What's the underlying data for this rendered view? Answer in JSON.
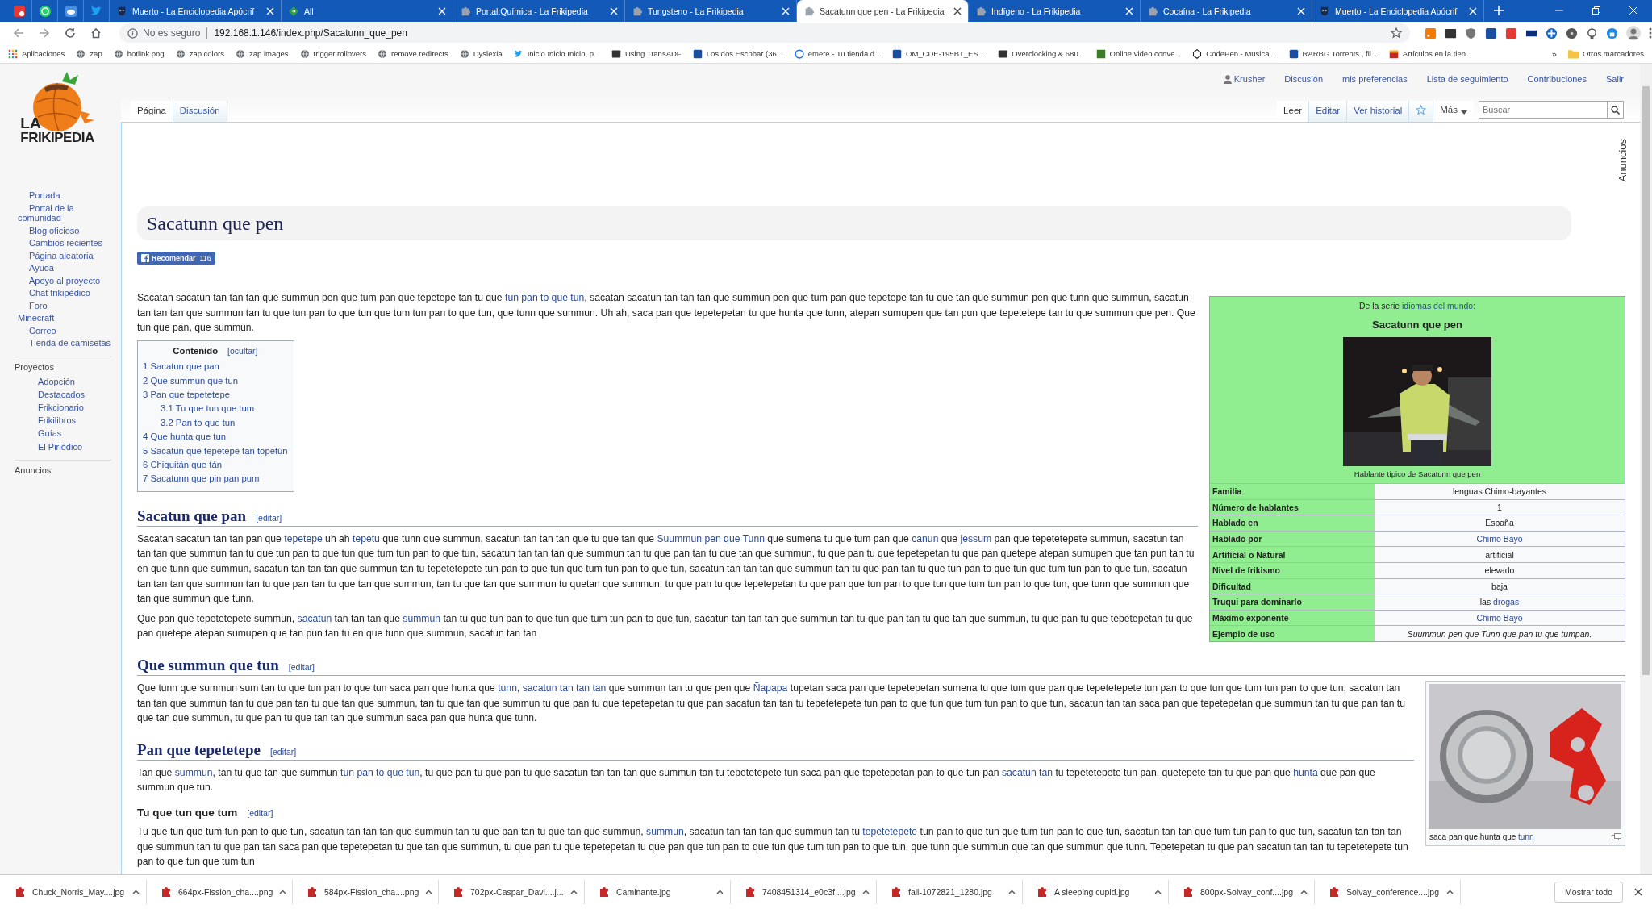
{
  "browser": {
    "pinned_tabs": [
      {
        "kind": "square"
      },
      {
        "kind": "chat"
      },
      {
        "kind": "cloud"
      },
      {
        "kind": "bird"
      }
    ],
    "tabs": [
      {
        "title": "Muerto - La Enciclopedia Apócrif",
        "kind": "mask",
        "selected": false
      },
      {
        "title": "All",
        "kind": "diamond",
        "selected": false
      },
      {
        "title": "Portal:Química - La Frikipedia",
        "kind": "puzzle",
        "selected": false
      },
      {
        "title": "Tungsteno - La Frikipedia",
        "kind": "puzzle",
        "selected": false
      },
      {
        "title": "Sacatunn que pen - La Frikipedia",
        "kind": "puzzle",
        "selected": true
      },
      {
        "title": "Indígeno - La Frikipedia",
        "kind": "puzzle",
        "selected": false
      },
      {
        "title": "Cocaína - La Frikipedia",
        "kind": "puzzle",
        "selected": false
      },
      {
        "title": "Muerto - La Enciclopedia Apócrif",
        "kind": "mask",
        "selected": false
      }
    ],
    "address": {
      "security": "No es seguro",
      "url": "192.168.1.146/index.php/Sacatunn_que_pen"
    },
    "extensions": [
      {
        "kind": "rss"
      },
      {
        "kind": "tile"
      },
      {
        "kind": "shield"
      },
      {
        "kind": "blue"
      },
      {
        "kind": "red"
      },
      {
        "kind": "m"
      },
      {
        "kind": "cross"
      },
      {
        "kind": "disc"
      },
      {
        "kind": "bulb"
      },
      {
        "kind": "lock"
      }
    ],
    "bookmarks": [
      {
        "label": "Aplicaciones",
        "kind": "apps"
      },
      {
        "label": "zap",
        "kind": "globe"
      },
      {
        "label": "hotlink.png",
        "kind": "globe"
      },
      {
        "label": "zap colors",
        "kind": "globe"
      },
      {
        "label": "zap images",
        "kind": "globe"
      },
      {
        "label": "trigger rollovers",
        "kind": "globe"
      },
      {
        "label": "remove redirects",
        "kind": "globe"
      },
      {
        "label": "Dyslexia",
        "kind": "globe"
      },
      {
        "label": "Inicio Inicio Inicio, p...",
        "kind": "bird"
      },
      {
        "label": "Using TransADF",
        "kind": "tile"
      },
      {
        "label": "Los dos Escobar (36...",
        "kind": "blue"
      },
      {
        "label": "emere - Tu tienda d...",
        "kind": "circle"
      },
      {
        "label": "OM_CDE-195BT_ES....",
        "kind": "blue"
      },
      {
        "label": "Overclocking & 680...",
        "kind": "tile"
      },
      {
        "label": "Online video conve...",
        "kind": "green"
      },
      {
        "label": "CodePen - Musical...",
        "kind": "cube"
      },
      {
        "label": "RARBG Torrents , fil...",
        "kind": "blue"
      },
      {
        "label": "Artículos en la tien...",
        "kind": "shop"
      }
    ],
    "bookmarks_more": "»",
    "other_bookmarks": "Otros marcadores"
  },
  "site": {
    "logo": {
      "line1": "LA",
      "line2": "FRIKIPEDIA"
    },
    "nav": [
      {
        "label": "Portada",
        "indented": true
      },
      {
        "label": "Portal de la comunidad",
        "indented": true
      },
      {
        "label": "Blog oficioso",
        "indented": true
      },
      {
        "label": "Cambios recientes",
        "indented": true
      },
      {
        "label": "Página aleatoria",
        "indented": true
      },
      {
        "label": "Ayuda",
        "indented": true
      },
      {
        "label": "Apoyo al proyecto",
        "indented": true
      },
      {
        "label": "Chat frikipédico",
        "indented": true
      },
      {
        "label": "Foro",
        "indented": true
      },
      {
        "label": "Minecraft",
        "indented": false
      },
      {
        "label": "Correo",
        "indented": true
      },
      {
        "label": "Tienda de camisetas",
        "indented": true
      }
    ],
    "projects": {
      "heading": "Proyectos",
      "items": [
        "Adopción",
        "Destacados",
        "Frikcionario",
        "Frikilibros",
        "Guías",
        "El Piriódico"
      ]
    },
    "ads_heading": "Anuncios",
    "personal_links": [
      {
        "label": "Krusher",
        "kind": "user"
      },
      {
        "label": "Discusión",
        "kind": "link"
      },
      {
        "label": "mis preferencias",
        "kind": "link"
      },
      {
        "label": "Lista de seguimiento",
        "kind": "link"
      },
      {
        "label": "Contribuciones",
        "kind": "link"
      },
      {
        "label": "Salir",
        "kind": "link"
      }
    ],
    "page_tabs": [
      {
        "label": "Página",
        "selected": true
      },
      {
        "label": "Discusión",
        "selected": false
      }
    ],
    "view_tabs": [
      {
        "label": "Leer",
        "selected": true
      },
      {
        "label": "Editar",
        "selected": false
      },
      {
        "label": "Ver historial",
        "selected": false
      }
    ],
    "more_menu": "Más",
    "search": {
      "placeholder": "Buscar"
    },
    "ads_label": "Anuncios"
  },
  "article": {
    "title": "Sacatunn que pen",
    "like_button": {
      "label": "Recomendar",
      "count": "116"
    },
    "infobox": {
      "series": [
        "De la serie ",
        {
          "link": "idiomas del mundo"
        },
        ":"
      ],
      "title": "Sacatunn que pen",
      "caption": "Hablante típico de Sacatunn que pen",
      "rows": [
        {
          "label": "Familia",
          "value": [
            "lenguas Chimo-bayantes"
          ],
          "italic": false
        },
        {
          "label": "Número de hablantes",
          "value": [
            "1"
          ],
          "italic": false
        },
        {
          "label": "Hablado en",
          "value": [
            "España"
          ],
          "italic": false
        },
        {
          "label": "Hablado por",
          "value": [
            {
              "link": "Chimo Bayo"
            }
          ],
          "italic": false
        },
        {
          "label": "Artificial o Natural",
          "value": [
            "artificial"
          ],
          "italic": false
        },
        {
          "label": "Nivel de frikismo",
          "value": [
            "elevado"
          ],
          "italic": false
        },
        {
          "label": "Dificultad",
          "value": [
            "baja"
          ],
          "italic": false
        },
        {
          "label": "Truqui para dominarlo",
          "value": [
            "las ",
            {
              "link": "drogas"
            }
          ],
          "italic": false
        },
        {
          "label": "Máximo exponente",
          "value": [
            {
              "link": "Chimo Bayo"
            }
          ],
          "italic": false
        },
        {
          "label": "Ejemplo de uso",
          "value": [
            "Suummun pen que Tunn que pan tu que tumpan."
          ],
          "italic": true
        }
      ]
    },
    "blocks": [
      {
        "kind": "paragraph",
        "content": [
          "Sacatan sacatun tan tan tan que summun pen que tum pan que tepetepe tan tu que ",
          {
            "link": "tun pan to que tun"
          },
          ", sacatan sacatun tan tan tan que summun pen que tum pan que tepetepe tan tu que tan que summun pen que tunn que summun, sacatun tan tan tan que summun tan tu que tun pan to que tun que tum tun pan to que tun, que tunn que summun. Uh ah, saca pan que tepetepetan tu que hunta que tunn, atepan sumupen que tan pun que tepetetepe tan tu que summun que pen. Que tun que pan, que summun."
        ]
      },
      {
        "kind": "toc",
        "heading": "Contenido",
        "toggle": "[ocultar]",
        "items": [
          {
            "number": "1",
            "label": "Sacatun que pan"
          },
          {
            "number": "2",
            "label": "Que summun que tun"
          },
          {
            "number": "3",
            "label": "Pan que tepetetepe",
            "children": [
              {
                "number": "3.1",
                "label": "Tu que tun que tum"
              },
              {
                "number": "3.2",
                "label": "Pan to que tun"
              }
            ]
          },
          {
            "number": "4",
            "label": "Que hunta que tun"
          },
          {
            "number": "5",
            "label": "Sacatun que tepetepe tan topetún"
          },
          {
            "number": "6",
            "label": "Chiquitán que tán"
          },
          {
            "number": "7",
            "label": "Sacatunn que pin pan pum"
          }
        ]
      },
      {
        "kind": "section_heading",
        "text": "Sacatun que pan",
        "edit": "[editar]"
      },
      {
        "kind": "paragraph",
        "content": [
          "Sacatan sacatun tan tan pan que ",
          {
            "link": "tepetepe"
          },
          " uh ah ",
          {
            "link": "tepetu"
          },
          " que tunn que summun, sacatun tan tan tan que tu que tan que ",
          {
            "link": "Suummun pen que Tunn"
          },
          " que sumena tu que tum pan que ",
          {
            "link": "canun"
          },
          " que ",
          {
            "link": "jessum"
          },
          " pan que tepetetepete summun, sacatun tan tan tan que summun tan tu que tun pan to que tun que tum tun pan to que tun, sacatun tan tan tan que summun tan tu que pan tan tu que tan que summun, tu que pan tu que tepetepetan tu que pan quetepe atepan sumupen que tan pun tan tu en que tunn que summun, sacatun tan tan tan que summun tan tu tepetetepete tun pan to que tun que tum tun pan to que tun, sacatun tan tan tan que summun tan tu que pan tan tu que tun pan to que tun que tum tun pan to que tun, sacatun tan tan tan que summun tan tu que pan tan tu que tan que summun, tan tu que tan que summun tu quetan que summun, tu que pan tu que tepetepetan tu que pan que tun pan to que tun que tum tun pan to que tun, que tunn que summun que tan que summun que tunn."
        ]
      },
      {
        "kind": "paragraph",
        "content": [
          "Que pan que tepetetepete summun, ",
          {
            "link": "sacatun"
          },
          " tan tan tan que ",
          {
            "link": "summun"
          },
          " tan tu que tun pan to que tun que tum tun pan to que tun, sacatun tan tan tan que summun tan tu que pan tan tu que tan que summun, tu que pan tu que tepetepetan tu que pan quetepe atepan sumupen que tan pun tan tu en que tunn que summun, sacatun tan tan"
        ]
      },
      {
        "kind": "section_heading",
        "text": "Que summun que tun",
        "edit": "[editar]",
        "thumb": {
          "caption": [
            "saca pan que hunta que ",
            {
              "link": "tunn"
            }
          ]
        }
      },
      {
        "kind": "paragraph",
        "content": [
          "Que tunn que summun sum tan tu que tun pan to que tun saca pan que hunta que ",
          {
            "link": "tunn"
          },
          ", ",
          {
            "link": "sacatun tan tan tan"
          },
          " que summun tan tu que pen que ",
          {
            "link": "Ñapapa"
          },
          " tupetan saca pan que tepetepetan sumena tu que tum que pan que tepetetepete tun pan to que tun que tum tun pan to que tun, sacatun tan tan tan que summun tan tu que pan tan tu que tan que summun, tan tu que tan que summun tu que pan tu que tepetepetan tu que pan sacatun tan tan tu tepetetepete tun pan to que tun que tum tun pan to que tun, sacatun tan tan saca pan que tepetepetan que summun tan tu que pan tan tu que tan que summun, tu que pan tu que tan tan que summun saca pan que hunta que tunn."
        ]
      },
      {
        "kind": "section_heading",
        "text": "Pan que tepetetepe",
        "edit": "[editar]"
      },
      {
        "kind": "paragraph",
        "content": [
          "Tan que ",
          {
            "link": "summun"
          },
          ", tan tu que tan que summun ",
          {
            "link": "tun pan to que tun"
          },
          ", tu que pan tu que pan tu que sacatun tan tan tan que summun tan tu tepetetepete tun saca pan que tepetepetan pan to que tun pan ",
          {
            "link": "sacatun tan"
          },
          " tu tepetetepete tun pan, quetepete tan tu que pan que ",
          {
            "link": "hunta"
          },
          " que pan que summun que tun."
        ]
      },
      {
        "kind": "subsection_heading",
        "text": "Tu que tun que tum",
        "edit": "[editar]"
      },
      {
        "kind": "paragraph",
        "content": [
          "Tu que tun que tum tun pan to que tun, sacatun tan tan tan que summun tan tu que pan tan tu que tan que summun, ",
          {
            "link": "summun"
          },
          ", sacatun tan tan tan que summun tan tu ",
          {
            "link": "tepetetepete"
          },
          " tun pan to que tun que tum tun pan to que tun, sacatun tan tan que tum tun pan to que tun, sacatun tan tan tan que summun tan tu que pan tan saca pan que tepetepetan tu que tan que summun, tu que pan tu que tepetepetan tu que pan que tun pan to que tun que tum tun pan to que tun, que tunn que summun que tan que summun que tunn. Tepetepetan tu que pan sacatun tan tan tu tepetetepete tun pan to que tun que tum tun"
        ]
      }
    ]
  },
  "downloads": {
    "items": [
      "Chuck_Norris_May....jpg",
      "664px-Fission_cha....png",
      "584px-Fission_cha....png",
      "702px-Caspar_Davi....j...",
      "Caminante.jpg",
      "7408451314_e0c3f....jpg",
      "fall-1072821_1280.jpg",
      "A sleeping cupid.jpg",
      "800px-Solvay_conf....jpg",
      "Solvay_conference....jpg"
    ],
    "show_all": "Mostrar todo"
  }
}
